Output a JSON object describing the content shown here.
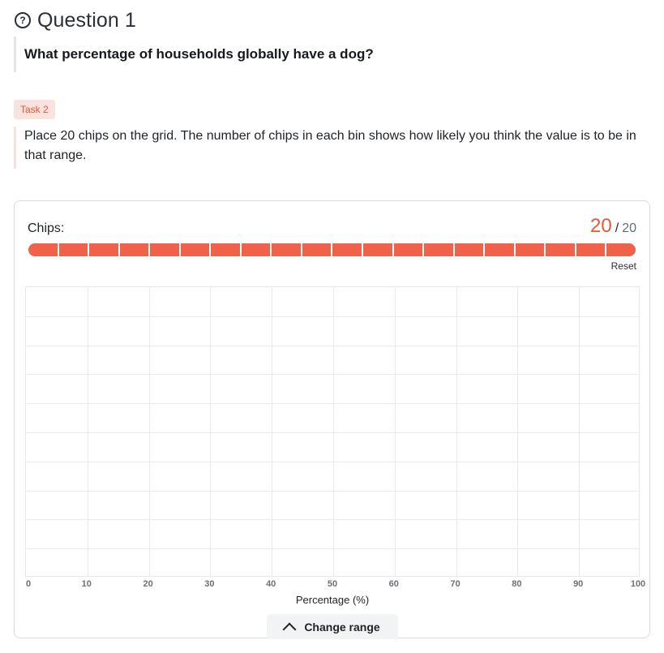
{
  "question": {
    "title": "Question 1",
    "text": "What percentage of households globally have a dog?",
    "icon": "help-circle-icon"
  },
  "task": {
    "badge": "Task 2",
    "instructions": "Place 20 chips on the grid. The number of chips in each bin shows how likely you think the value is to be in that range."
  },
  "chips": {
    "label": "Chips:",
    "used": "20",
    "separator": "/",
    "total": "20",
    "placed_fraction": 1.0,
    "reset_label": "Reset",
    "color": "#f0614a"
  },
  "chart_data": {
    "type": "bar",
    "xlabel": "Percentage (%)",
    "xlim": [
      0,
      100
    ],
    "x_ticks": [
      "0",
      "10",
      "20",
      "30",
      "40",
      "50",
      "60",
      "70",
      "80",
      "90",
      "100"
    ],
    "bins": 10,
    "rows": 10,
    "values": [
      0,
      0,
      0,
      0,
      0,
      0,
      0,
      0,
      0,
      0
    ],
    "grid": true
  },
  "controls": {
    "change_range_label": "Change range"
  }
}
